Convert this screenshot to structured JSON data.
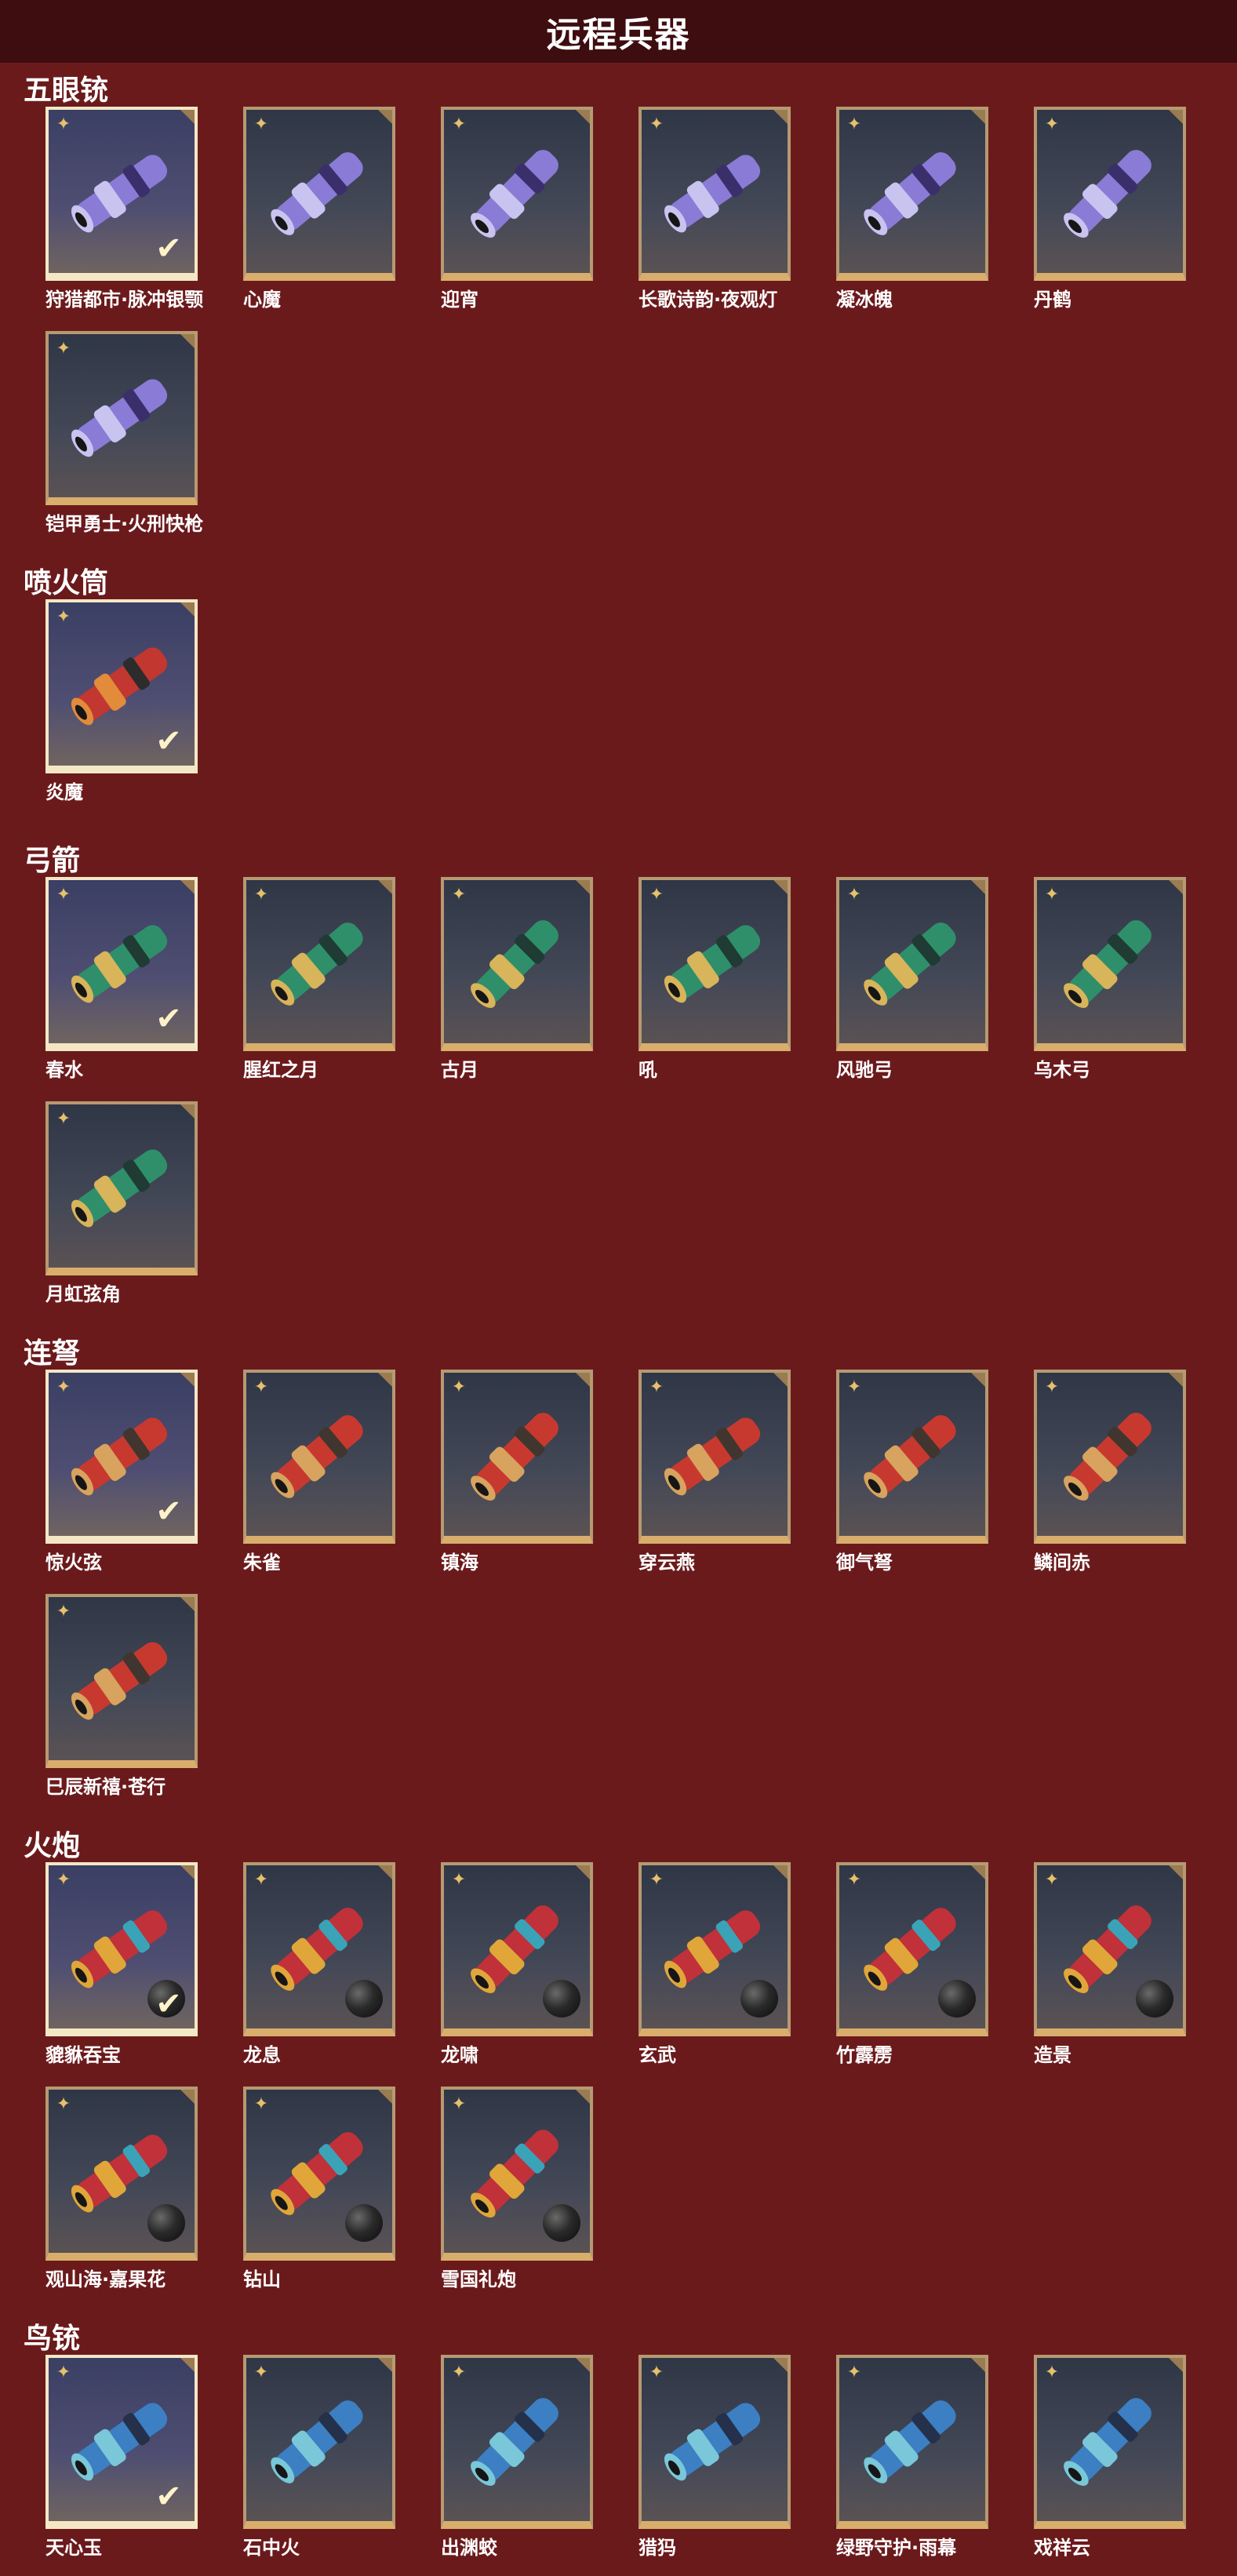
{
  "page_title": "远程兵器",
  "colors": {
    "background": "#6b1a1c",
    "title_bar": "#3d0d10",
    "card_border": "#d9ae6c",
    "rarity_star": "#e6c06b"
  },
  "icons": {
    "rarity": "four-point-star-icon",
    "owned": "checkmark-icon",
    "ammo": "cannonball-icon"
  },
  "sections": [
    {
      "title": "五眼铳",
      "items": [
        {
          "name": "狩猎都市·脉冲银颚",
          "owned": true,
          "art": "purple-cannon-artwork"
        },
        {
          "name": "心魔",
          "owned": false,
          "art": "dark-dragon-cannon-artwork"
        },
        {
          "name": "迎宵",
          "owned": false,
          "art": "red-lion-cannon-artwork"
        },
        {
          "name": "长歌诗韵·夜观灯",
          "owned": false,
          "art": "jade-fish-cannon-artwork"
        },
        {
          "name": "凝冰魄",
          "owned": false,
          "art": "ice-cannon-artwork"
        },
        {
          "name": "丹鹤",
          "owned": false,
          "art": "crane-cannon-artwork"
        },
        {
          "name": "铠甲勇士·火刑快枪",
          "owned": false,
          "art": "red-armor-gun-artwork"
        }
      ]
    },
    {
      "title": "喷火筒",
      "items": [
        {
          "name": "炎魔",
          "owned": true,
          "art": "flame-tube-artwork"
        }
      ]
    },
    {
      "title": "弓箭",
      "items": [
        {
          "name": "春水",
          "owned": true,
          "art": "jade-bow-artwork"
        },
        {
          "name": "腥红之月",
          "owned": false,
          "art": "crimson-bow-artwork"
        },
        {
          "name": "古月",
          "owned": false,
          "art": "golden-bow-artwork"
        },
        {
          "name": "吼",
          "owned": false,
          "art": "steel-bow-artwork"
        },
        {
          "name": "风驰弓",
          "owned": false,
          "art": "wind-bow-artwork"
        },
        {
          "name": "乌木弓",
          "owned": false,
          "art": "ebony-bow-artwork"
        },
        {
          "name": "月虹弦角",
          "owned": false,
          "art": "moon-bow-artwork"
        }
      ]
    },
    {
      "title": "连弩",
      "items": [
        {
          "name": "惊火弦",
          "owned": true,
          "art": "fire-crossbow-artwork"
        },
        {
          "name": "朱雀",
          "owned": false,
          "art": "vermilion-crossbow-artwork"
        },
        {
          "name": "镇海",
          "owned": false,
          "art": "sea-crossbow-artwork"
        },
        {
          "name": "穿云燕",
          "owned": false,
          "art": "swallow-crossbow-artwork"
        },
        {
          "name": "御气弩",
          "owned": false,
          "art": "silver-crossbow-artwork"
        },
        {
          "name": "鳞间赤",
          "owned": false,
          "art": "koi-crossbow-artwork"
        },
        {
          "name": "巳辰新禧·苍行",
          "owned": false,
          "art": "snake-crossbow-artwork"
        }
      ]
    },
    {
      "title": "火炮",
      "items": [
        {
          "name": "貔貅吞宝",
          "owned": true,
          "ammo": true,
          "art": "pixiu-cannon-artwork"
        },
        {
          "name": "龙息",
          "owned": false,
          "ammo": true,
          "art": "golden-dragon-cannon-artwork"
        },
        {
          "name": "龙啸",
          "owned": false,
          "ammo": true,
          "art": "azure-dragon-cannon-artwork"
        },
        {
          "name": "玄武",
          "owned": false,
          "ammo": true,
          "art": "tortoise-cannon-artwork"
        },
        {
          "name": "竹霹雳",
          "owned": false,
          "ammo": true,
          "art": "bamboo-cannon-artwork"
        },
        {
          "name": "造景",
          "owned": false,
          "ammo": true,
          "art": "cyan-beast-cannon-artwork"
        },
        {
          "name": "观山海·嘉果花",
          "owned": false,
          "ammo": true,
          "art": "flower-cannon-artwork"
        },
        {
          "name": "钻山",
          "owned": false,
          "ammo": true,
          "art": "drill-cannon-artwork"
        },
        {
          "name": "雪国礼炮",
          "owned": false,
          "ammo": true,
          "art": "snow-cannon-artwork"
        }
      ]
    },
    {
      "title": "鸟铳",
      "items": [
        {
          "name": "天心玉",
          "owned": true,
          "art": "jade-musket-artwork"
        },
        {
          "name": "石中火",
          "owned": false,
          "art": "stone-musket-artwork"
        },
        {
          "name": "出渊蛟",
          "owned": false,
          "art": "dragon-musket-artwork"
        },
        {
          "name": "猎犸",
          "owned": false,
          "art": "hunter-musket-artwork"
        },
        {
          "name": "绿野守护·雨幕",
          "owned": false,
          "art": "green-musket-artwork"
        },
        {
          "name": "戏祥云",
          "owned": false,
          "art": "cloud-musket-artwork"
        }
      ]
    }
  ]
}
